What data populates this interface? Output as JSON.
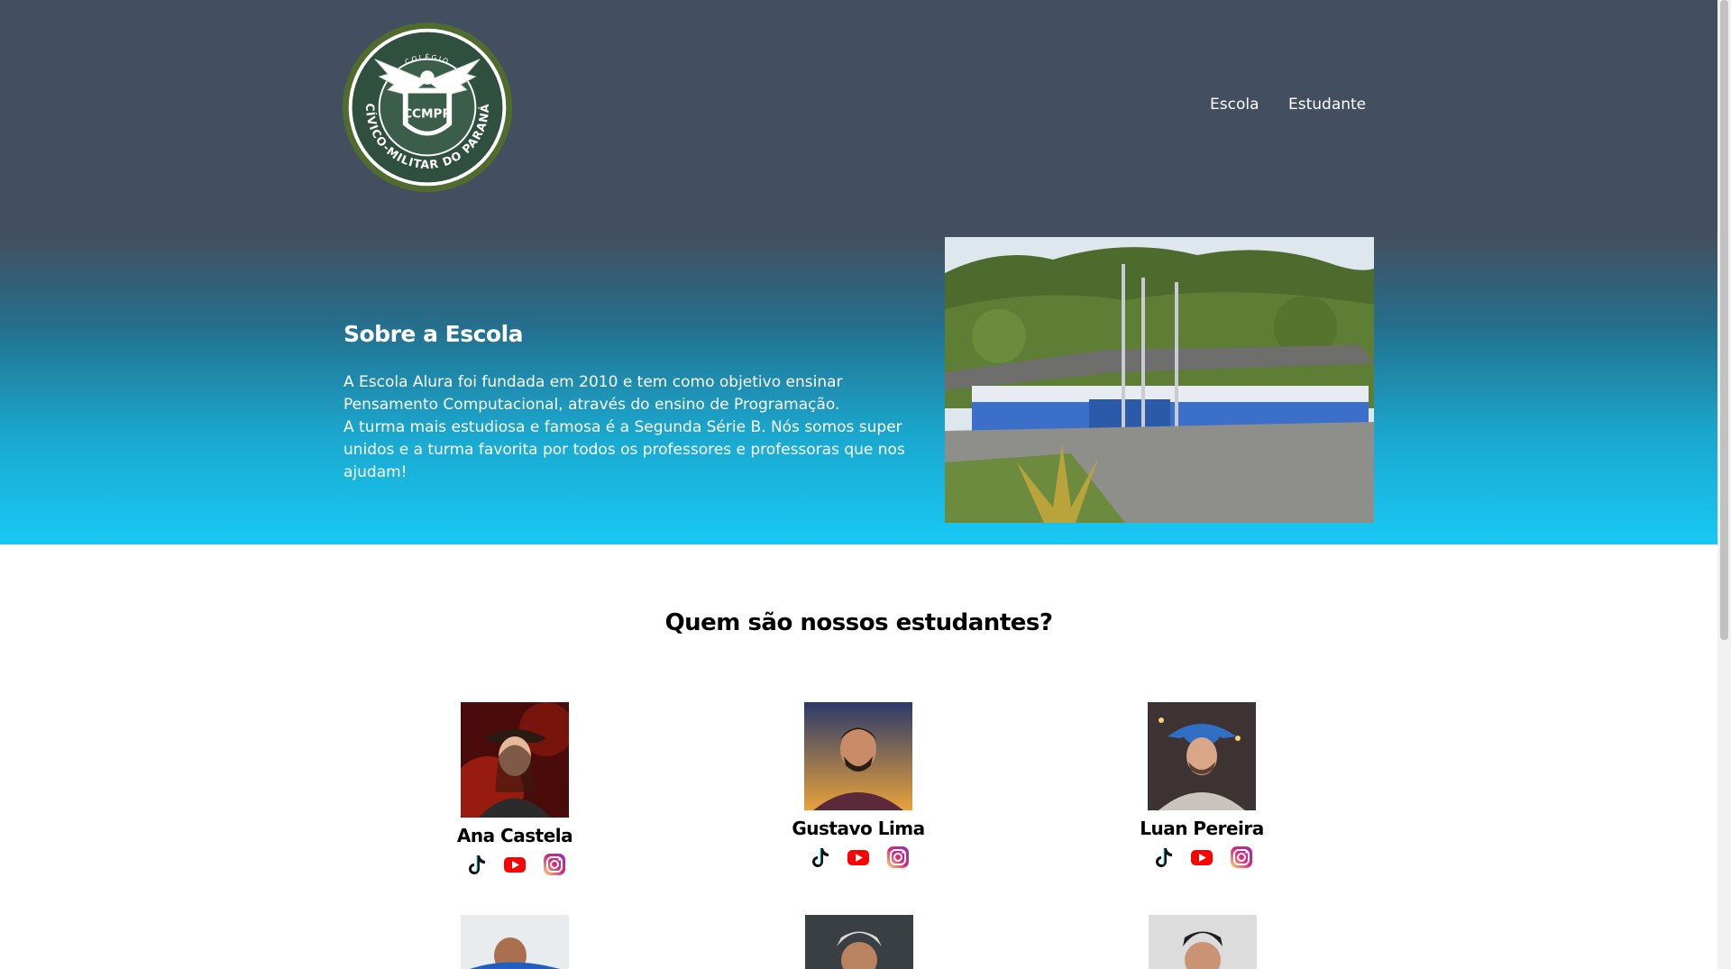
{
  "header": {
    "logo": {
      "top_text": "COLÉGIO",
      "ring_text": "CÍVICO-MILITAR DO PARANÁ",
      "badge_text": "CCMPR"
    },
    "nav": [
      {
        "label": "Escola"
      },
      {
        "label": "Estudante"
      }
    ]
  },
  "hero": {
    "title": "Sobre a Escola",
    "paragraph1": "A Escola Alura foi fundada em 2010 e tem como objetivo ensinar Pensamento Computacional, através do ensino de Programação.",
    "paragraph2": "A turma mais estudiosa e famosa é a Segunda Série B. Nós somos super unidos e a turma favorita por todos os professores e professoras que nos ajudam!"
  },
  "students_section": {
    "title": "Quem são nossos estudantes?",
    "students": [
      {
        "name": "Ana Castela",
        "socials": [
          "tiktok-icon",
          "youtube-icon",
          "instagram-icon"
        ]
      },
      {
        "name": "Gustavo Lima",
        "socials": [
          "tiktok-icon",
          "youtube-icon",
          "instagram-icon"
        ]
      },
      {
        "name": "Luan Pereira",
        "socials": [
          "tiktok-icon",
          "youtube-icon",
          "instagram-icon"
        ]
      }
    ]
  },
  "colors": {
    "header_bg": "#434f60",
    "hero_gradient_end": "#18c9f4",
    "logo_green": "#4f6b2e",
    "youtube_red": "#ff0000"
  }
}
